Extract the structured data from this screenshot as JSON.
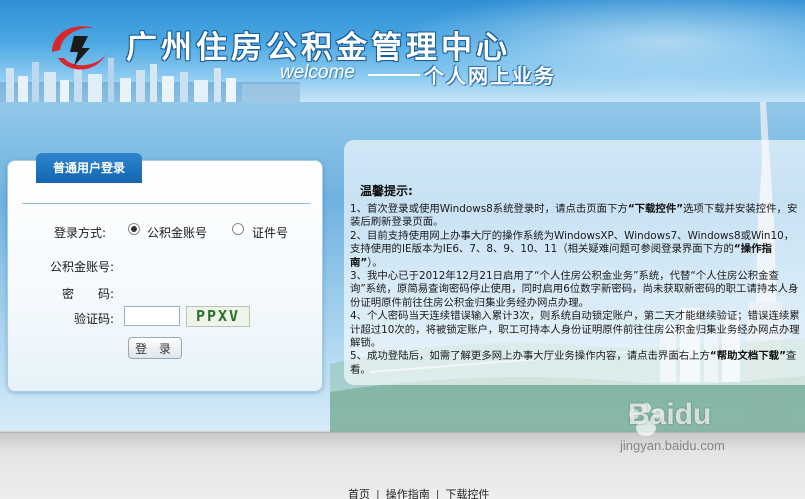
{
  "header": {
    "title": "广州住房公积金管理中心",
    "welcome": "welcome",
    "subtitle": "个人网上业务"
  },
  "login": {
    "tab_label": "普通用户登录",
    "login_method_label": "登录方式:",
    "options": [
      {
        "label": "公积金账号",
        "selected": true
      },
      {
        "label": "证件号",
        "selected": false
      }
    ],
    "account_label": "公积金账号:",
    "password_label": "密　　码:",
    "captcha_label": "验证码:",
    "captcha_value": "",
    "captcha_code": "PPXV",
    "submit_label": "登 录"
  },
  "notice": {
    "title": "温馨提示:",
    "items": [
      {
        "pre": "1、首次登录或使用Windows8系统登录时，请点击页面下方",
        "bold": "“下载控件”",
        "post": "选项下载并安装控件，安装后刷新登录页面。"
      },
      {
        "pre": "2、目前支持使用网上办事大厅的操作系统为WindowsXP、Windows7、Windows8或Win10，支持使用的IE版本为IE6、7、8、9、10、11（相关疑难问题可参阅登录界面下方的",
        "bold": "“操作指南”",
        "post": "）。"
      },
      {
        "pre": "3、我中心已于2012年12月21日启用了“个人住房公积金业务”系统，代替“个人住房公积金查询”系统，原简易查询密码停止使用，同时启用6位数字新密码，尚未获取新密码的职工请持本人身份证明原件前往住房公积金归集业务经办网点办理。",
        "bold": "",
        "post": ""
      },
      {
        "pre": "4、个人密码当天连续错误输入累计3次，则系统自动锁定账户，第二天才能继续验证；错误连续累计超过10次的，将被锁定账户，职工可持本人身份证明原件前往住房公积金归集业务经办网点办理解锁。",
        "bold": "",
        "post": ""
      },
      {
        "pre": "5、成功登陆后，如需了解更多网上办事大厅业务操作内容，请点击界面右上方",
        "bold": "“帮助文档下载”",
        "post": "查看。"
      }
    ]
  },
  "footer": {
    "links": [
      "首页",
      "操作指南",
      "下载控件"
    ],
    "separator": "|"
  },
  "watermark": {
    "brand": "Baidu",
    "url": "jingyan.baidu.com"
  },
  "colors": {
    "accent": "#1465b0",
    "panel_border": "#a9cbe6",
    "captcha_text": "#2d6d2d"
  }
}
